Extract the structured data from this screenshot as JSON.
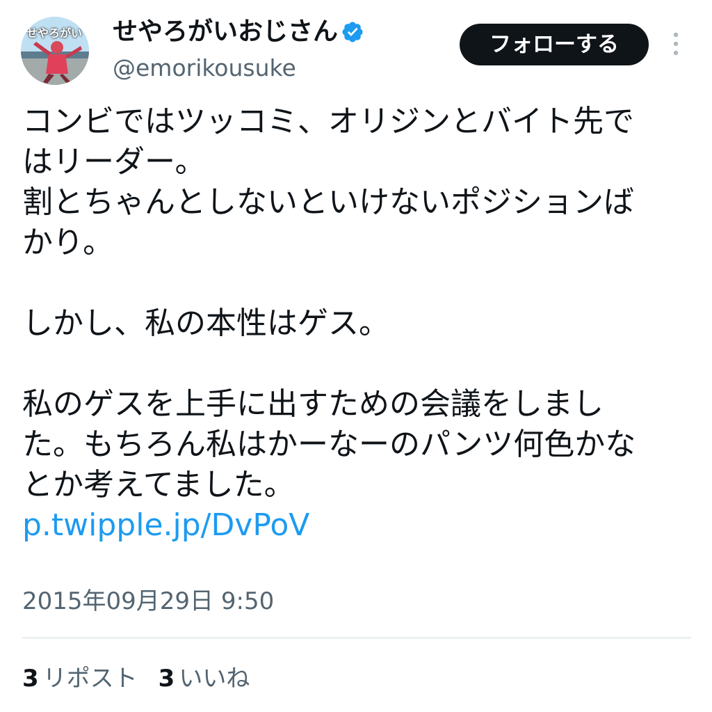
{
  "author": {
    "display_name": "せやろがいおじさん",
    "handle": "@emorikousuke",
    "avatar_text": "せやろがい",
    "verified": true
  },
  "actions": {
    "follow_label": "フォローする"
  },
  "tweet": {
    "lines_para1": [
      "コンビではツッコミ、オリジンとバイト先で",
      "はリーダー。",
      "割とちゃんとしないといけないポジションば",
      "かり。"
    ],
    "lines_para2": [
      "しかし、私の本性はゲス。"
    ],
    "lines_para3": [
      "私のゲスを上手に出すための会議をしまし",
      "た。もちろん私はかーなーのパンツ何色かな",
      "とか考えてました。"
    ],
    "link": "p.twipple.jp/DvPoV",
    "timestamp": "2015年09月29日 9:50"
  },
  "stats": {
    "reposts_count": "3",
    "reposts_label": "リポスト",
    "likes_count": "3",
    "likes_label": "いいね"
  },
  "colors": {
    "text": "#0f1419",
    "secondary": "#536471",
    "link": "#1d9bf0",
    "verified": "#1d9bf0",
    "button_bg": "#0f1419"
  }
}
